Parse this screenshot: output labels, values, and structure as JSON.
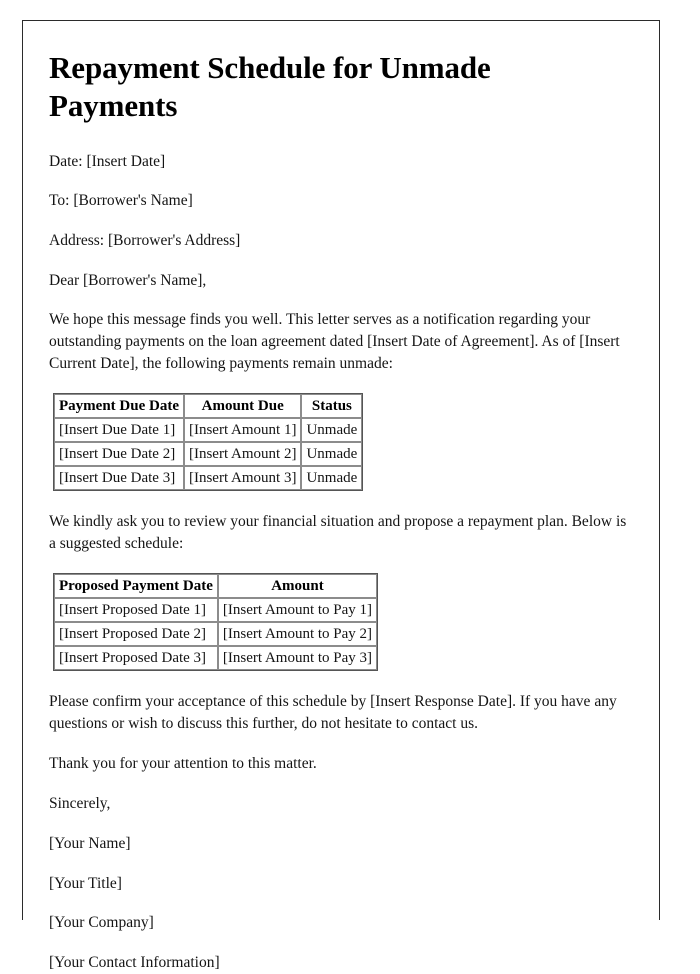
{
  "document": {
    "title": "Repayment Schedule for Unmade Payments",
    "meta": {
      "date_line": "Date: [Insert Date]",
      "to_line": "To: [Borrower's Name]",
      "address_line": "Address: [Borrower's Address]",
      "salutation": "Dear [Borrower's Name],"
    },
    "body": {
      "intro_paragraph": "We hope this message finds you well. This letter serves as a notification regarding your outstanding payments on the loan agreement dated [Insert Date of Agreement]. As of [Insert Current Date], the following payments remain unmade:",
      "request_paragraph": "We kindly ask you to review your financial situation and propose a repayment plan. Below is a suggested schedule:",
      "confirm_paragraph": "Please confirm your acceptance of this schedule by [Insert Response Date]. If you have any questions or wish to discuss this further, do not hesitate to contact us.",
      "thanks_paragraph": "Thank you for your attention to this matter."
    },
    "unmade_payments_table": {
      "headers": [
        "Payment Due Date",
        "Amount Due",
        "Status"
      ],
      "rows": [
        [
          "[Insert Due Date 1]",
          "[Insert Amount 1]",
          "Unmade"
        ],
        [
          "[Insert Due Date 2]",
          "[Insert Amount 2]",
          "Unmade"
        ],
        [
          "[Insert Due Date 3]",
          "[Insert Amount 3]",
          "Unmade"
        ]
      ]
    },
    "proposed_schedule_table": {
      "headers": [
        "Proposed Payment Date",
        "Amount"
      ],
      "rows": [
        [
          "[Insert Proposed Date 1]",
          "[Insert Amount to Pay 1]"
        ],
        [
          "[Insert Proposed Date 2]",
          "[Insert Amount to Pay 2]"
        ],
        [
          "[Insert Proposed Date 3]",
          "[Insert Amount to Pay 3]"
        ]
      ]
    },
    "signature": {
      "closing": "Sincerely,",
      "name": "[Your Name]",
      "job_title": "[Your Title]",
      "company": "[Your Company]",
      "contact": "[Your Contact Information]"
    }
  }
}
